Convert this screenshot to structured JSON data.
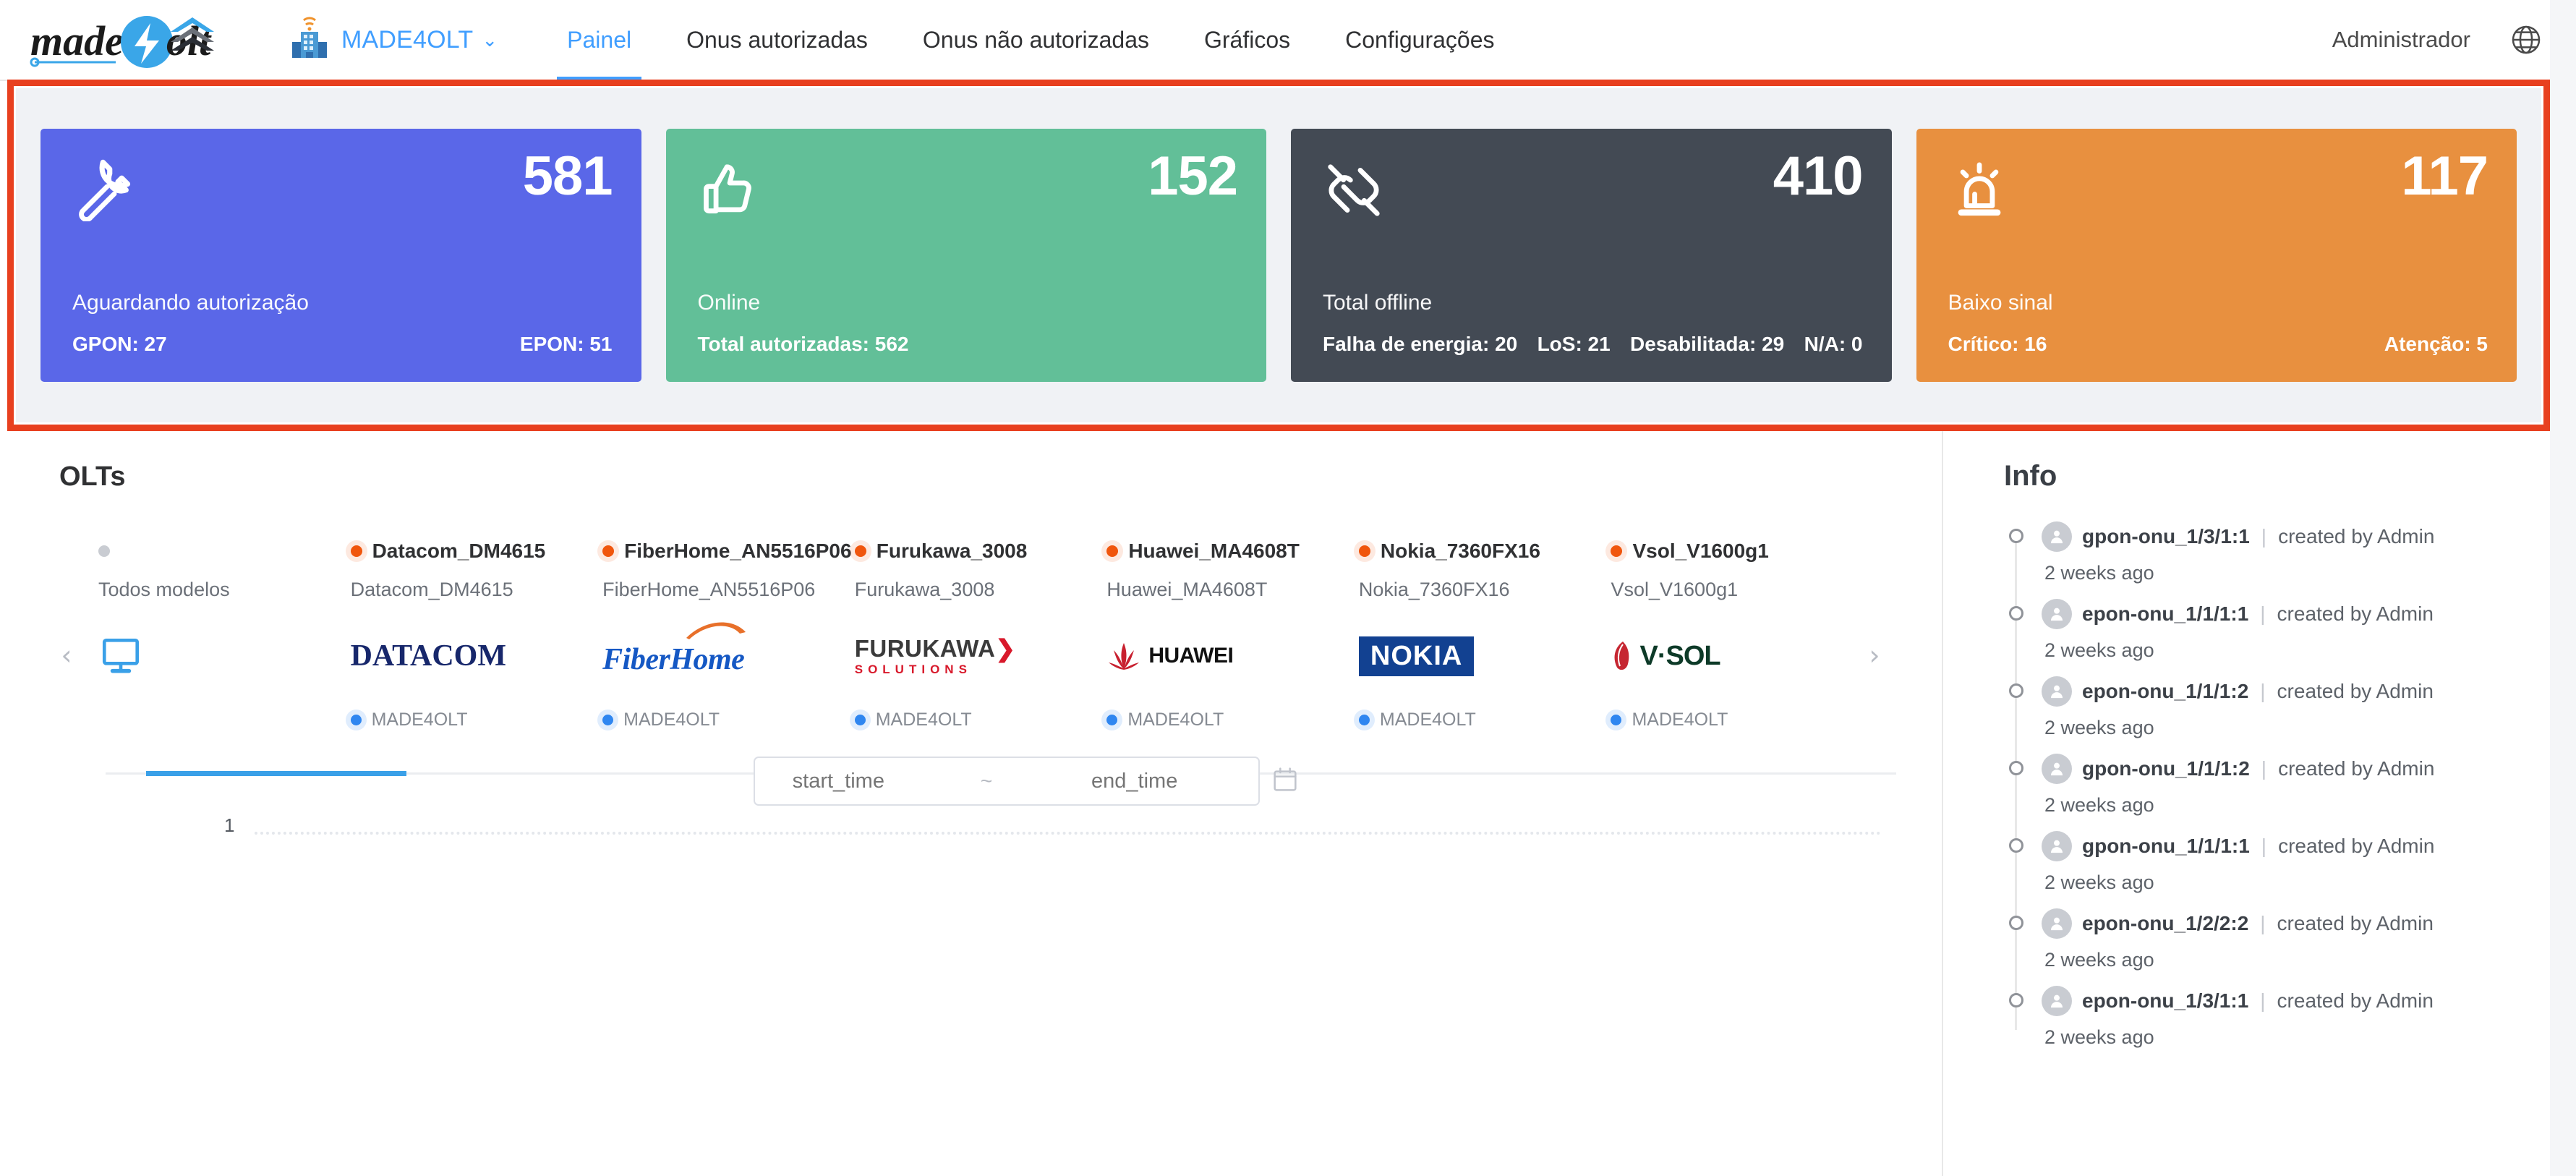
{
  "header": {
    "brand_name": "made4olt",
    "org_name": "MADE4OLT",
    "org_caret": "⌄",
    "nav": [
      {
        "label": "Painel",
        "active": true
      },
      {
        "label": "Onus autorizadas",
        "active": false
      },
      {
        "label": "Onus não autorizadas",
        "active": false
      },
      {
        "label": "Gráficos",
        "active": false
      },
      {
        "label": "Configurações",
        "active": false
      }
    ],
    "user_label": "Administrador",
    "language_icon": "globe-icon"
  },
  "stats": [
    {
      "id": "aguardando-autorizacao",
      "icon": "wrench-icon",
      "value": "581",
      "title": "Aguardando autorização",
      "color": "#5a67e8",
      "subs": [
        {
          "label": "GPON: 27"
        },
        {
          "label": "EPON: 51"
        }
      ]
    },
    {
      "id": "online",
      "icon": "thumbs-up-icon",
      "value": "152",
      "title": "Online",
      "color": "#62bf98",
      "subs": [
        {
          "label": "Total autorizadas: 562"
        }
      ]
    },
    {
      "id": "total-offline",
      "icon": "broken-link-icon",
      "value": "410",
      "title": "Total offline",
      "color": "#434a54",
      "subs": [
        {
          "label": "Falha de energia: 20"
        },
        {
          "label": "LoS: 21"
        },
        {
          "label": "Desabilitada: 29"
        },
        {
          "label": "N/A: 0"
        }
      ]
    },
    {
      "id": "baixo-sinal",
      "icon": "siren-icon",
      "value": "117",
      "title": "Baixo sinal",
      "color": "#e8903f",
      "subs": [
        {
          "label": "Crítico: 16"
        },
        {
          "label": "Atenção: 5"
        }
      ]
    }
  ],
  "olts": {
    "title": "OLTs",
    "prev_arrow": "‹",
    "next_arrow": "›",
    "items": [
      {
        "name": "",
        "sub": "Todos modelos",
        "logo": "monitor-icon",
        "footer": "",
        "dot": "grey",
        "all_models": true
      },
      {
        "name": "Datacom_DM4615",
        "sub": "Datacom_DM4615",
        "logo": "datacom-logo",
        "footer": "MADE4OLT",
        "dot": "orange"
      },
      {
        "name": "FiberHome_AN5516P06",
        "sub": "FiberHome_AN5516P06",
        "logo": "fiberhome-logo",
        "footer": "MADE4OLT",
        "dot": "orange"
      },
      {
        "name": "Furukawa_3008",
        "sub": "Furukawa_3008",
        "logo": "furukawa-logo",
        "footer": "MADE4OLT",
        "dot": "orange"
      },
      {
        "name": "Huawei_MA4608T",
        "sub": "Huawei_MA4608T",
        "logo": "huawei-logo",
        "footer": "MADE4OLT",
        "dot": "orange"
      },
      {
        "name": "Nokia_7360FX16",
        "sub": "Nokia_7360FX16",
        "logo": "nokia-logo",
        "footer": "MADE4OLT",
        "dot": "orange"
      },
      {
        "name": "Vsol_V1600g1",
        "sub": "Vsol_V1600g1",
        "logo": "vsol-logo",
        "footer": "MADE4OLT",
        "dot": "orange"
      }
    ],
    "logo_text": {
      "datacom": "DATACOM",
      "fiberhome": "FiberHome",
      "furukawa_main": "FURUKAWA",
      "furukawa_arrow": "❯",
      "furukawa_sub": "SOLUTIONS",
      "huawei": "HUAWEI",
      "nokia": "NOKIA",
      "vsol": "V·SOL"
    }
  },
  "date_range": {
    "start_placeholder": "start_time",
    "separator": "~",
    "end_placeholder": "end_time",
    "calendar_icon": "calendar-icon",
    "start_value": "",
    "end_value": ""
  },
  "chart_data": {
    "type": "line",
    "title": "",
    "xlabel": "",
    "ylabel": "",
    "categories": [],
    "values": [],
    "ytick_labels": [
      "1"
    ],
    "ylim": [
      0,
      1
    ],
    "grid": true,
    "legend": "none"
  },
  "info": {
    "title": "Info",
    "created_by_text": "created by Admin",
    "divider": "|",
    "entries": [
      {
        "name": "gpon-onu_1/3/1:1",
        "by": "created by Admin",
        "time": "2 weeks ago"
      },
      {
        "name": "epon-onu_1/1/1:1",
        "by": "created by Admin",
        "time": "2 weeks ago"
      },
      {
        "name": "epon-onu_1/1/1:2",
        "by": "created by Admin",
        "time": "2 weeks ago"
      },
      {
        "name": "gpon-onu_1/1/1:2",
        "by": "created by Admin",
        "time": "2 weeks ago"
      },
      {
        "name": "gpon-onu_1/1/1:1",
        "by": "created by Admin",
        "time": "2 weeks ago"
      },
      {
        "name": "epon-onu_1/2/2:2",
        "by": "created by Admin",
        "time": "2 weeks ago"
      },
      {
        "name": "epon-onu_1/3/1:1",
        "by": "created by Admin",
        "time": "2 weeks ago"
      }
    ]
  },
  "colors": {
    "accent_blue": "#409eff",
    "highlight_red": "#e8401f",
    "card_blue": "#5a67e8",
    "card_green": "#62bf98",
    "card_dark": "#434a54",
    "card_orange": "#e8903f",
    "page_bg": "#f0f2f5"
  }
}
